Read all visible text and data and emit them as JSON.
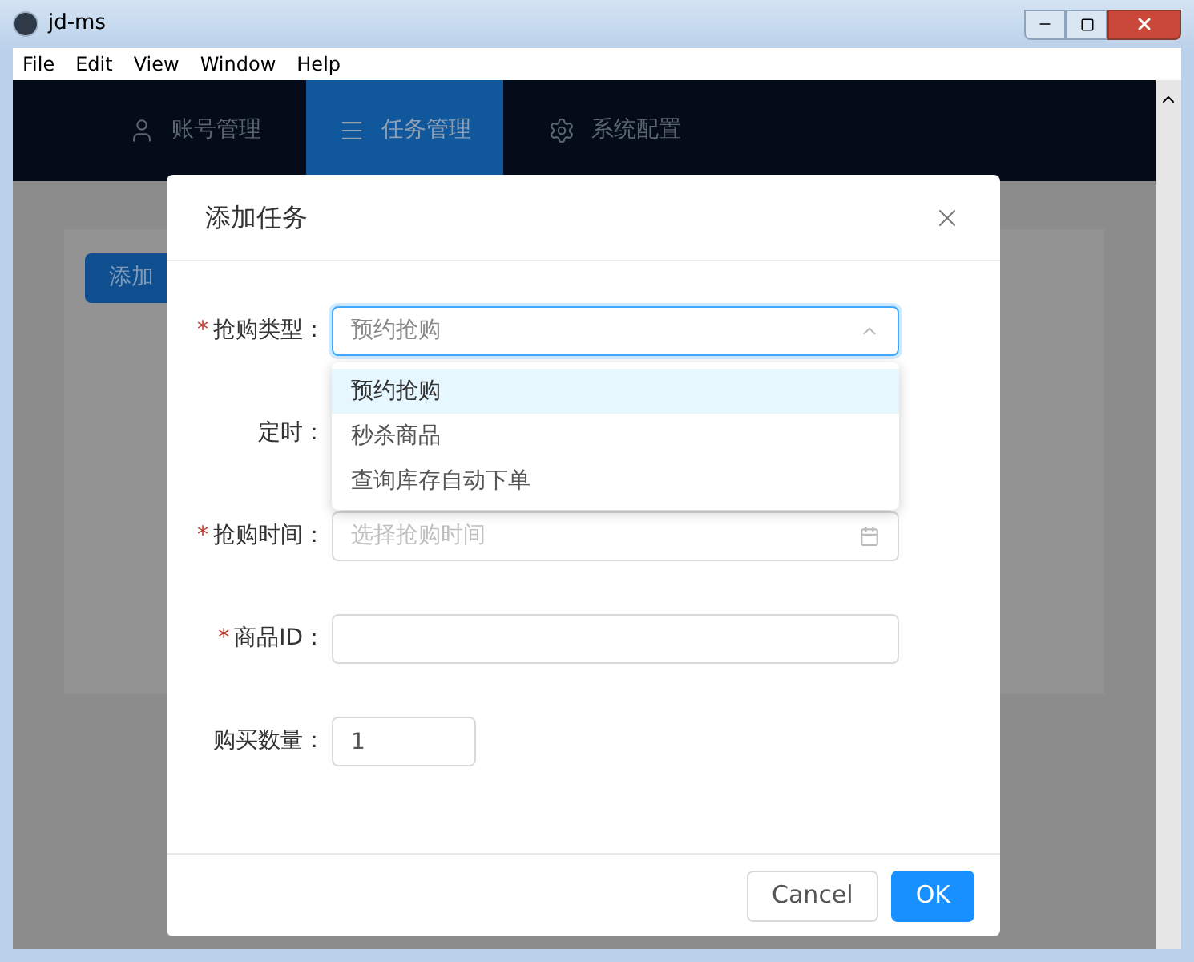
{
  "window": {
    "title": "jd-ms",
    "menu": [
      "File",
      "Edit",
      "View",
      "Window",
      "Help"
    ]
  },
  "nav": {
    "tabs": [
      {
        "label": "账号管理",
        "selected": false
      },
      {
        "label": "任务管理",
        "selected": true
      },
      {
        "label": "系统配置",
        "selected": false
      }
    ]
  },
  "page": {
    "add_button": "添加"
  },
  "dialog": {
    "title": "添加任务",
    "required_mark": "*",
    "fields": [
      {
        "label": "抢购类型：",
        "required": true,
        "kind": "select",
        "value": "预约抢购",
        "expanded": true
      },
      {
        "label": "定时：",
        "required": false,
        "kind": "covered"
      },
      {
        "label": "抢购时间：",
        "required": true,
        "kind": "date",
        "placeholder": "选择抢购时间"
      },
      {
        "label": "商品ID：",
        "required": true,
        "kind": "text"
      },
      {
        "label": "购买数量：",
        "required": false,
        "kind": "number",
        "value": "1"
      }
    ],
    "options": [
      {
        "label": "预约抢购",
        "selected": true
      },
      {
        "label": "秒杀商品",
        "selected": false
      },
      {
        "label": "查询库存自动下单",
        "selected": false
      }
    ],
    "buttons": [
      {
        "label": "Cancel",
        "kind": "default"
      },
      {
        "label": "OK",
        "kind": "primary"
      }
    ]
  }
}
